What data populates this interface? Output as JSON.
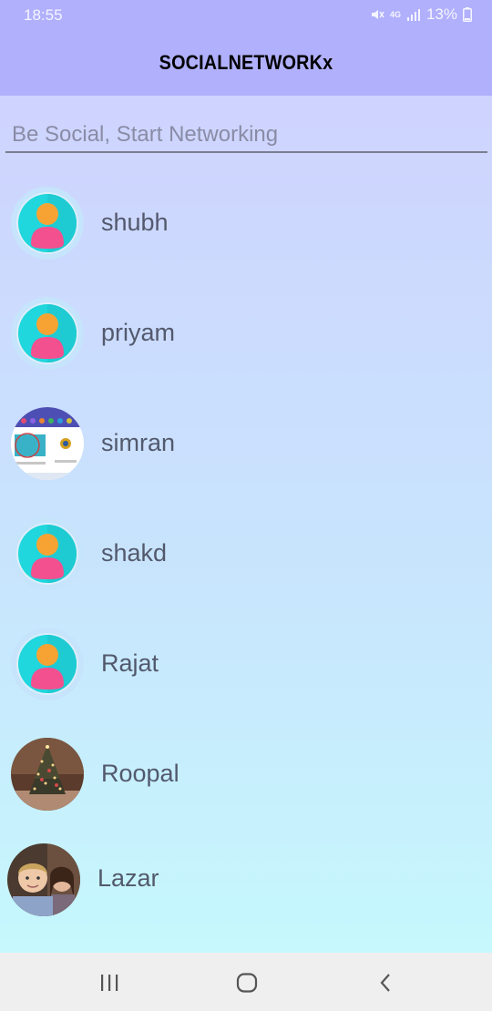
{
  "status_bar": {
    "time": "18:55",
    "network": "4G",
    "battery": "13%",
    "icons": [
      "mute-icon",
      "network-4g-icon",
      "signal-icon",
      "battery-icon"
    ]
  },
  "app_bar": {
    "title": "SOCIALNETWORKx",
    "color": "#b1b0fd"
  },
  "search": {
    "placeholder": "Be Social, Start Networking",
    "value": ""
  },
  "users": [
    {
      "name": "shubh",
      "avatar": "default-avatar"
    },
    {
      "name": "priyam",
      "avatar": "default-avatar"
    },
    {
      "name": "simran",
      "avatar": "photo-screenshot"
    },
    {
      "name": "shakd",
      "avatar": "default-avatar"
    },
    {
      "name": "Rajat",
      "avatar": "default-avatar"
    },
    {
      "name": "Roopal",
      "avatar": "photo-christmas-tree"
    },
    {
      "name": "Lazar",
      "avatar": "photo-people"
    }
  ],
  "nav_bar": {
    "buttons": [
      "recent-apps-icon",
      "home-icon",
      "back-icon"
    ]
  }
}
